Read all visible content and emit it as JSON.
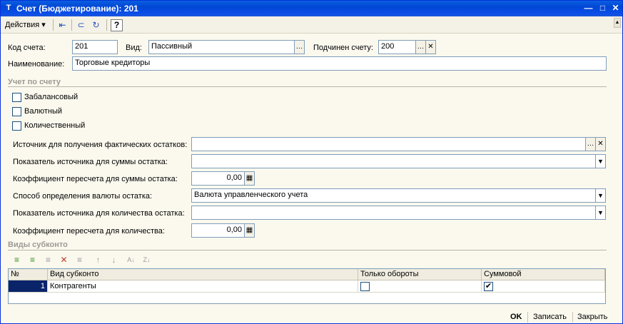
{
  "window": {
    "title": "Счет (Бюджетирование): 201",
    "title_icon": "Т"
  },
  "toolbar": {
    "actions_label": "Действия",
    "icons": [
      "back-arrow-icon",
      "structure-icon",
      "refresh-icon",
      "help-icon"
    ]
  },
  "form": {
    "code": {
      "label": "Код счета:",
      "value": "201"
    },
    "kind": {
      "label": "Вид:",
      "value": "Пассивный"
    },
    "parent": {
      "label": "Подчинен счету:",
      "value": "200"
    },
    "name": {
      "label": "Наименование:",
      "value": "Торговые кредиторы"
    }
  },
  "accounting": {
    "section_title": "Учет по счету",
    "checkboxes": [
      {
        "label": "Забалансовый",
        "checked": false
      },
      {
        "label": "Валютный",
        "checked": false
      },
      {
        "label": "Количественный",
        "checked": false
      }
    ],
    "source_actual": {
      "label": "Источник для получения фактических остатков:",
      "value": ""
    },
    "source_sum_indicator": {
      "label": "Показатель источника для суммы остатка:",
      "value": ""
    },
    "sum_coefficient": {
      "label": "Коэффициент пересчета для суммы остатка:",
      "value": "0,00"
    },
    "currency_method": {
      "label": "Способ определения валюты остатка:",
      "value": "Валюта управленческого учета"
    },
    "source_qty_indicator": {
      "label": "Показатель источника для количества остатка:",
      "value": ""
    },
    "qty_coefficient": {
      "label": "Коэффициент пересчета для количества:",
      "value": "0,00"
    }
  },
  "subconto": {
    "section_title": "Виды субконто",
    "columns": [
      "№",
      "Вид субконто",
      "Только обороты",
      "Суммовой"
    ],
    "rows": [
      {
        "num": "1",
        "kind": "Контрагенты",
        "turnover_only": false,
        "sum": true
      }
    ]
  },
  "footer": {
    "ok": "OK",
    "save": "Записать",
    "close": "Закрыть"
  },
  "colors": {
    "title_bar": "#0a5fe0",
    "form_bg": "#fbf9ee",
    "selected_row": "#0a246a"
  }
}
